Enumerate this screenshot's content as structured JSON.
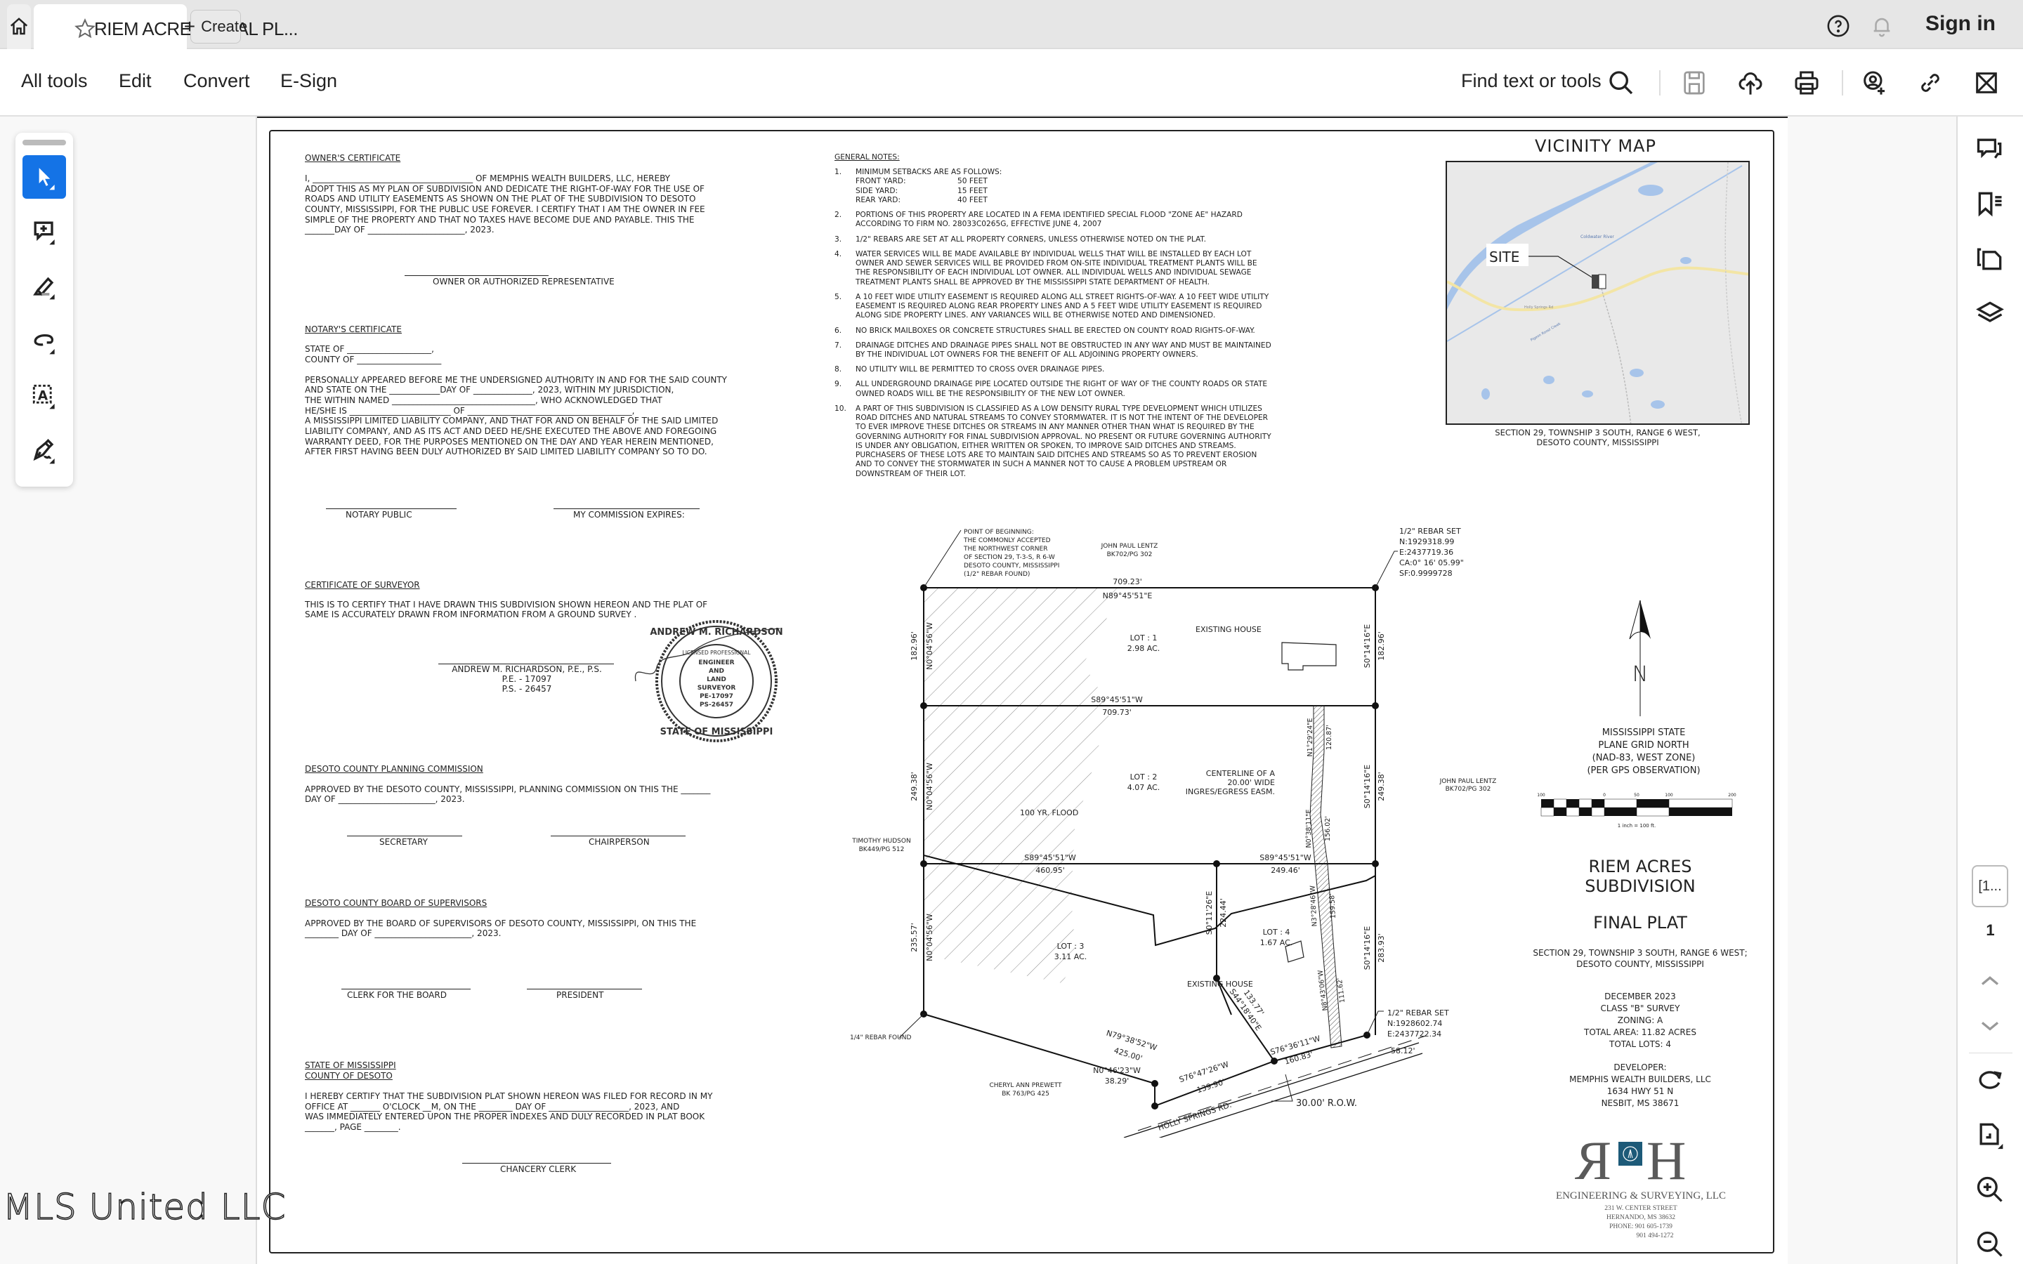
{
  "app": {
    "tab_title": "RIEM ACRES FINAL PL...",
    "create_label": "Create",
    "sign_in_label": "Sign in",
    "icons": {
      "home": "home-icon",
      "star": "star-icon",
      "close": "close-icon",
      "help": "help-icon",
      "bell": "bell-icon"
    }
  },
  "toolbar": {
    "menus": [
      "All tools",
      "Edit",
      "Convert",
      "E-Sign"
    ],
    "find_label": "Find text or tools",
    "icons": [
      "search-icon",
      "save-icon",
      "cloud-upload-icon",
      "print-icon",
      "share-user-icon",
      "link-icon",
      "mail-icon"
    ]
  },
  "left_rail": {
    "tools": [
      "select-tool",
      "add-comment-tool",
      "highlight-tool",
      "draw-tool",
      "text-select-tool",
      "sign-tool"
    ]
  },
  "right_rail": {
    "panels": [
      "comments-icon",
      "bookmarks-icon",
      "pages-icon",
      "layers-icon"
    ],
    "page_box_label": "[1...",
    "current_page": "1",
    "bottom_icons": [
      "chevron-up-icon",
      "chevron-down-icon",
      "refresh-icon",
      "page-fit-icon",
      "zoom-in-icon",
      "zoom-out-icon"
    ]
  },
  "watermark": "MLS United LLC",
  "plat": {
    "owners_cert": {
      "heading": "OWNER'S CERTIFICATE",
      "lines": [
        "I, ______________________________________ OF MEMPHIS WEALTH BUILDERS, LLC, HEREBY",
        "ADOPT THIS AS MY PLAN OF SUBDIVISION AND DEDICATE THE RIGHT-OF-WAY FOR THE USE OF",
        "ROADS AND UTILITY EASEMENTS AS SHOWN ON THE PLAT OF THE SUBDIVISION TO DESOTO",
        "COUNTY, MISSISSIPPI, FOR THE PUBLIC USE FOREVER. I CERTIFY THAT I AM THE OWNER IN FEE",
        "SIMPLE OF THE PROPERTY AND THAT NO TAXES HAVE BECOME DUE AND PAYABLE. THIS THE",
        "_______DAY OF _______________________, 2023."
      ],
      "signature_label": "OWNER OR AUTHORIZED REPRESENTATIVE"
    },
    "notary_cert": {
      "heading": "NOTARY'S CERTIFICATE",
      "state_of": "STATE OF ____________________,",
      "county_of": "COUNTY OF ____________________",
      "lines": [
        "PERSONALLY APPEARED BEFORE ME THE UNDERSIGNED AUTHORITY IN AND FOR THE SAID COUNTY",
        "AND STATE ON THE ____________DAY OF ______________, 2023, WITHIN MY JURISDICTION,",
        "THE WITHIN NAMED __________________________________, WHO ACKNOWLEDGED THAT",
        "HE/SHE IS ________________________ OF _______________________________________,",
        "A MISSISSIPPI LIMITED LIABILITY COMPANY, AND THAT FOR AND ON BEHALF OF THE SAID LIMITED",
        "LIABILITY COMPANY, AND AS ITS ACT AND DEED HE/SHE EXECUTED THE ABOVE AND FOREGOING",
        "WARRANTY DEED, FOR THE PURPOSES MENTIONED ON THE DAY AND YEAR HEREIN MENTIONED,",
        "AFTER FIRST HAVING BEEN DULY AUTHORIZED BY SAID LIMITED LIABILITY COMPANY SO TO DO."
      ],
      "sig_left": "NOTARY PUBLIC",
      "sig_right": "MY COMMISSION EXPIRES:"
    },
    "surveyor_cert": {
      "heading": "CERTIFICATE OF SURVEYOR",
      "lines": [
        "THIS IS TO CERTIFY THAT I HAVE DRAWN THIS SUBDIVISION SHOWN HEREON AND THE PLAT OF",
        "SAME IS ACCURATELY DRAWN FROM INFORMATION FROM A GROUND SURVEY ."
      ],
      "signer": [
        "ANDREW M. RICHARDSON, P.E., P.S.",
        "P.E. - 17097",
        "P.S. - 26457"
      ],
      "seal": {
        "outer_top": "ANDREW M. RICHARDSON",
        "outer_bottom": "STATE OF MISSISSIPPI",
        "ring": "LICENSED PROFESSIONAL",
        "center": [
          "ENGINEER",
          "AND",
          "LAND",
          "SURVEYOR",
          "PE-17097",
          "PS-26457"
        ]
      }
    },
    "planning_commission": {
      "heading": "DESOTO COUNTY PLANNING COMMISSION",
      "lines": [
        "APPROVED BY THE DESOTO COUNTY, MISSISSIPPI, PLANNING COMMISSION ON THIS THE _______",
        "DAY OF _______________________, 2023."
      ],
      "sig_left": "SECRETARY",
      "sig_right": "CHAIRPERSON"
    },
    "board_supervisors": {
      "heading": "DESOTO COUNTY BOARD OF SUPERVISORS",
      "lines": [
        "APPROVED BY THE BOARD OF SUPERVISORS OF DESOTO COUNTY, MISSISSIPPI, ON THIS THE",
        "________ DAY OF _______________________, 2023."
      ],
      "sig_left": "CLERK FOR THE BOARD",
      "sig_right": "PRESIDENT"
    },
    "recording": {
      "heading1": "STATE OF MISSISSIPPI",
      "heading2": "COUNTY OF DESOTO",
      "lines": [
        "I HEREBY CERTIFY THAT THE SUBDIVISION PLAT SHOWN HEREON WAS FILED FOR RECORD IN MY",
        "OFFICE AT _______ O'CLOCK __M, ON THE ________ DAY OF ___________________, 2023, AND",
        "WAS IMMEDIATELY ENTERED UPON THE PROPER INDEXES AND DULY RECORDED IN PLAT BOOK",
        "_______, PAGE ________."
      ],
      "sig": "CHANCERY CLERK"
    },
    "general_notes": {
      "heading": "GENERAL NOTES:",
      "items": [
        {
          "num": "1.",
          "text": "MINIMUM SETBACKS ARE AS FOLLOWS:",
          "setbacks": [
            [
              "FRONT YARD:",
              "50 FEET"
            ],
            [
              "SIDE YARD:",
              "15 FEET"
            ],
            [
              "REAR YARD:",
              "40 FEET"
            ]
          ]
        },
        {
          "num": "2.",
          "text": "PORTIONS OF THIS PROPERTY ARE LOCATED IN A FEMA IDENTIFIED SPECIAL FLOOD \"ZONE AE\" HAZARD ACCORDING TO FIRM NO. 28033C0265G, EFFECTIVE JUNE 4, 2007"
        },
        {
          "num": "3.",
          "text": "1/2\" REBARS ARE SET AT ALL PROPERTY CORNERS, UNLESS OTHERWISE NOTED ON THE PLAT."
        },
        {
          "num": "4.",
          "text": "WATER SERVICES WILL BE MADE AVAILABLE BY INDIVIDUAL WELLS THAT WILL BE INSTALLED BY EACH LOT OWNER AND SEWER SERVICES WILL BE PROVIDED FROM ON-SITE INDIVIDUAL TREATMENT PLANTS WILL BE THE RESPONSIBILITY OF EACH INDIVIDUAL LOT OWNER.  ALL INDIVIDUAL WELLS AND INDIVIDUAL SEWAGE TREATMENT PLANTS SHALL BE APPROVED BY THE MISSISSIPPI STATE DEPARTMENT OF HEALTH."
        },
        {
          "num": "5.",
          "text": "A 10 FEET WIDE UTILITY EASEMENT IS REQUIRED ALONG ALL STREET RIGHTS-OF-WAY.  A 10 FEET WIDE UTILITY EASEMENT IS REQUIRED ALONG REAR PROPERTY LINES AND A 5 FEET WIDE UTILITY EASEMENT IS REQUIRED ALONG SIDE PROPERTY LINES.  ANY VARIANCES WILL BE OTHERWISE NOTED AND DIMENSIONED."
        },
        {
          "num": "6.",
          "text": "NO BRICK MAILBOXES OR CONCRETE STRUCTURES SHALL BE ERECTED ON COUNTY ROAD RIGHTS-OF-WAY."
        },
        {
          "num": "7.",
          "text": "DRAINAGE DITCHES AND DRAINAGE PIPES SHALL NOT BE OBSTRUCTED IN ANY WAY AND MUST BE MAINTAINED BY THE INDIVIDUAL LOT OWNERS FOR THE BENEFIT OF ALL ADJOINING PROPERTY OWNERS."
        },
        {
          "num": "8.",
          "text": "NO UTILITY WILL BE PERMITTED TO CROSS OVER DRAINAGE PIPES."
        },
        {
          "num": "9.",
          "text": "ALL UNDERGROUND DRAINAGE PIPE LOCATED OUTSIDE THE RIGHT OF WAY OF THE COUNTY ROADS OR STATE OWNED ROADS WILL BE THE RESPONSIBILITY OF THE NEW LOT OWNER."
        },
        {
          "num": "10.",
          "text": "A PART OF THIS SUBDIVISION IS CLASSIFIED AS A LOW DENSITY RURAL TYPE DEVELOPMENT WHICH UTILIZES ROAD DITCHES AND NATURAL STREAMS TO CONVEY STORMWATER.  IT IS NOT THE INTENT OF THE DEVELOPER TO EVER IMPROVE THESE DITCHES OR STREAMS IN ANY MANNER OTHER THAN WHAT IS REQUIRED BY THE GOVERNING AUTHORITY FOR FINAL SUBDIVISION APPROVAL.  NO PRESENT OR FUTURE GOVERNING AUTHORITY IS UNDER ANY OBLIGATION, EITHER WRITTEN OR SPOKEN, TO IMPROVE SAID DITCHES AND STREAMS.  PURCHASERS OF THESE LOTS ARE TO MAINTAIN SAID DITCHES AND STREAMS SO AS TO PREVENT EROSION AND TO CONVEY THE STORMWATER IN SUCH A MANNER NOT TO CAUSE A PROBLEM UPSTREAM OR DOWNSTREAM OF THEIR LOT."
        }
      ]
    },
    "vicinity_map": {
      "title": "VICINITY MAP",
      "site_label": "SITE",
      "labels": [
        "Coldwater River",
        "Pigeon Roost Creek",
        "Holly Springs Rd"
      ],
      "caption": [
        "SECTION 29, TOWNSHIP 3 SOUTH, RANGE 6 WEST,",
        "DESOTO COUNTY, MISSISSIPPI"
      ]
    },
    "drawing": {
      "pob": [
        "POINT OF BEGINNING:",
        "THE COMMONLY ACCEPTED",
        "THE NORTHWEST CORNER",
        "OF SECTION 29, T-3-S, R 6-W",
        "DESOTO COUNTY, MISSISSIPPI",
        "(1/2\" REBAR FOUND)"
      ],
      "adjoiner_north": [
        "JOHN PAUL LENTZ",
        "BK702/PG 302"
      ],
      "adjoiner_east": [
        "JOHN PAUL LENTZ",
        "BK702/PG 302"
      ],
      "adjoiner_west": [
        "TIMOTHY HUDSON",
        "BK449/PG 512"
      ],
      "adjoiner_south": [
        "CHERYL ANN PREWETT",
        "BK 763/PG 425"
      ],
      "rebar_ne": [
        "1/2\" REBAR SET",
        "N:1929318.99",
        "E:2437719.36",
        "CA:0° 16' 05.99\"",
        "SF:0.9999728"
      ],
      "rebar_se": [
        "1/2\" REBAR SET",
        "N:1928602.74",
        "E:2437722.34"
      ],
      "rebar_sw": "1/4\" REBAR FOUND",
      "lots": [
        {
          "name": "LOT : 1",
          "area": "2.98 AC."
        },
        {
          "name": "LOT : 2",
          "area": "4.07 AC."
        },
        {
          "name": "LOT : 3",
          "area": "3.11 AC."
        },
        {
          "name": "LOT : 4",
          "area": "1.67 AC."
        }
      ],
      "calls": {
        "north_dist": "709.23'",
        "north_bearing": "N89°45'51\"E",
        "l12_bearing": "S89°45'51\"W",
        "l12_dist": "709.73'",
        "l23_bearing": "S89°45'51\"W",
        "l23_dist": "460.95'",
        "l24_bearing": "S89°45'51\"W",
        "l24_dist": "249.46'",
        "west1_dist": "182.96'",
        "west1_bearing": "N0°04'56\"W",
        "west2_dist": "249.38'",
        "west2_bearing": "N0°04'56\"W",
        "west3_dist": "235.57'",
        "west3_bearing": "N0°04'56\"W",
        "east1_bearing": "S0°14'16\"E",
        "east1_dist": "182.96'",
        "east2_bearing": "S0°14'16\"E",
        "east2_dist": "249.38'",
        "east3_bearing": "S0°14'16\"E",
        "east3_dist": "283.93'",
        "lot4w_bearing": "S0°11'26\"E",
        "lot4w_dist": "224.44'",
        "south_bearing": "N79°38'52\"W",
        "south_dist": "425.00'",
        "jog_bearing": "N0°46'23\"W",
        "jog_dist": "38.29'",
        "road1_bearing": "S76°47'26\"W",
        "road1_dist": "139.90'",
        "diag_bearing": "S44°18'40\"E",
        "diag_dist": "133.77'",
        "road2_bearing": "S76°36'11\"W",
        "road2_dist": "160.83'",
        "road3_dist": "58.12'",
        "easm1_bearing": "N1°29'24\"E",
        "easm1_dist": "120.87'",
        "easm2_bearing": "N0°38'11\"E",
        "easm2_dist": "156.02'",
        "easm3_bearing": "N3°28'46\"W",
        "easm3_dist": "159.58'",
        "easm4_bearing": "N8°43'06\"W",
        "easm4_dist": "111.62'"
      },
      "existing_house": "EXISTING HOUSE",
      "flood": "100 YR. FLOOD",
      "easement": [
        "CENTERLINE OF A",
        "20.00' WIDE",
        "INGRES/EGRESS EASM."
      ],
      "road": "HOLLY SPRINGS RD.",
      "row": "30.00' R.O.W."
    },
    "north_arrow": {
      "letter": "N",
      "lines": [
        "MISSISSIPPI STATE",
        "PLANE GRID NORTH",
        "(NAD-83, WEST ZONE)",
        "(PER GPS OBSERVATION)"
      ]
    },
    "scale_bar": {
      "ticks": [
        "100",
        "0",
        "50",
        "100",
        "200"
      ],
      "label": "1 inch = 100 ft."
    },
    "title_block": {
      "name": [
        "RIEM ACRES",
        "SUBDIVISION"
      ],
      "subtitle": "FINAL PLAT",
      "location": [
        "SECTION 29, TOWNSHIP 3 SOUTH, RANGE 6 WEST;",
        "DESOTO COUNTY, MISSISSIPPI"
      ],
      "info": [
        "DECEMBER 2023",
        "CLASS \"B\" SURVEY",
        "ZONING: A",
        "TOTAL AREA: 11.82 ACRES",
        "TOTAL LOTS: 4"
      ],
      "developer": [
        "DEVELOPER:",
        "MEMPHIS WEALTH BUILDERS, LLC",
        "1634 HWY 51 N",
        "NESBIT, MS 38671"
      ]
    },
    "firm": {
      "logo_letters": "RH",
      "name": "ENGINEERING & SURVEYING, LLC",
      "address": [
        "231 W. CENTER STREET",
        "HERNANDO, MS 38632",
        "PHONE: 901 605-1739",
        "901 494-1272"
      ],
      "logo_color": "#1d5a78"
    }
  }
}
